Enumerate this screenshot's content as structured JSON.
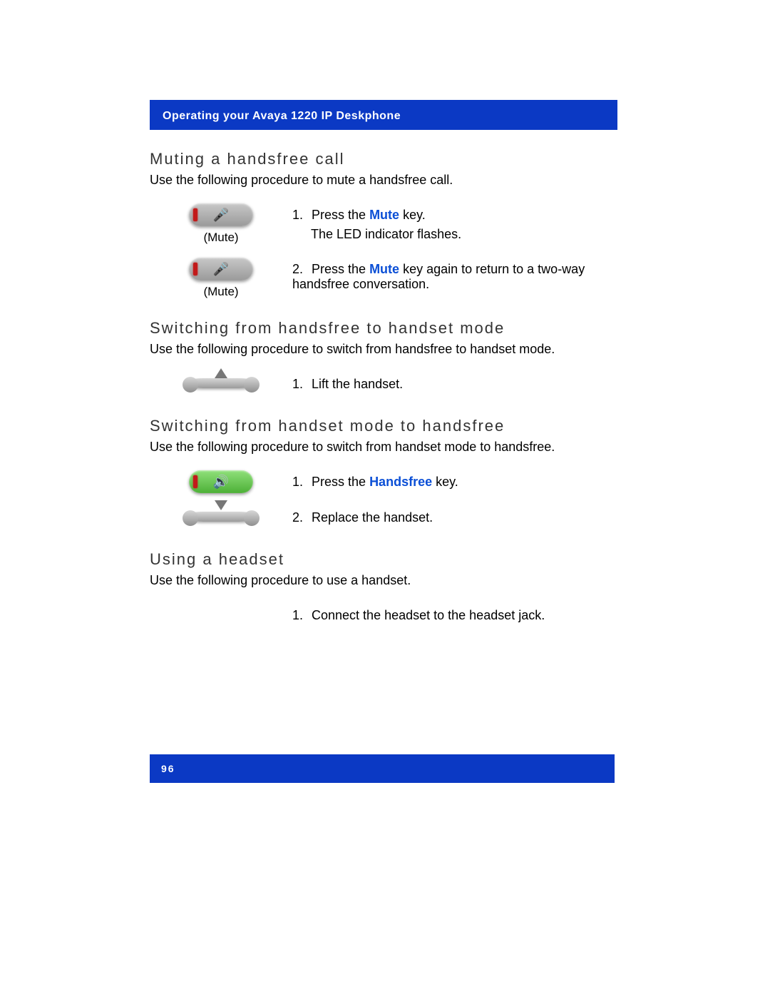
{
  "header": "Operating your Avaya 1220 IP Deskphone",
  "sections": {
    "mute": {
      "title": "Muting a handsfree call",
      "intro": "Use the following procedure to mute a handsfree call.",
      "step1_num": "1.",
      "step1_pre": "Press the ",
      "step1_key": "Mute",
      "step1_post": " key.",
      "step1_line2": "The LED indicator flashes.",
      "step2_num": "2.",
      "step2_pre": "Press the ",
      "step2_key": "Mute",
      "step2_post": " key again to return to a two-way handsfree conversation.",
      "caption": "(Mute)"
    },
    "hf2hs": {
      "title": "Switching from handsfree to handset mode",
      "intro": "Use the following procedure to switch from handsfree to handset mode.",
      "step1_num": "1.",
      "step1_text": "Lift the handset."
    },
    "hs2hf": {
      "title": "Switching from handset mode to handsfree",
      "intro": "Use the following procedure to switch from handset mode to handsfree.",
      "step1_num": "1.",
      "step1_pre": "Press the ",
      "step1_key": "Handsfree",
      "step1_post": " key.",
      "step2_num": "2.",
      "step2_text": "Replace the handset."
    },
    "headset": {
      "title": "Using a headset",
      "intro": "Use the following procedure to use a handset.",
      "step1_num": "1.",
      "step1_text": "Connect the headset to the headset jack."
    }
  },
  "page_number": "96"
}
